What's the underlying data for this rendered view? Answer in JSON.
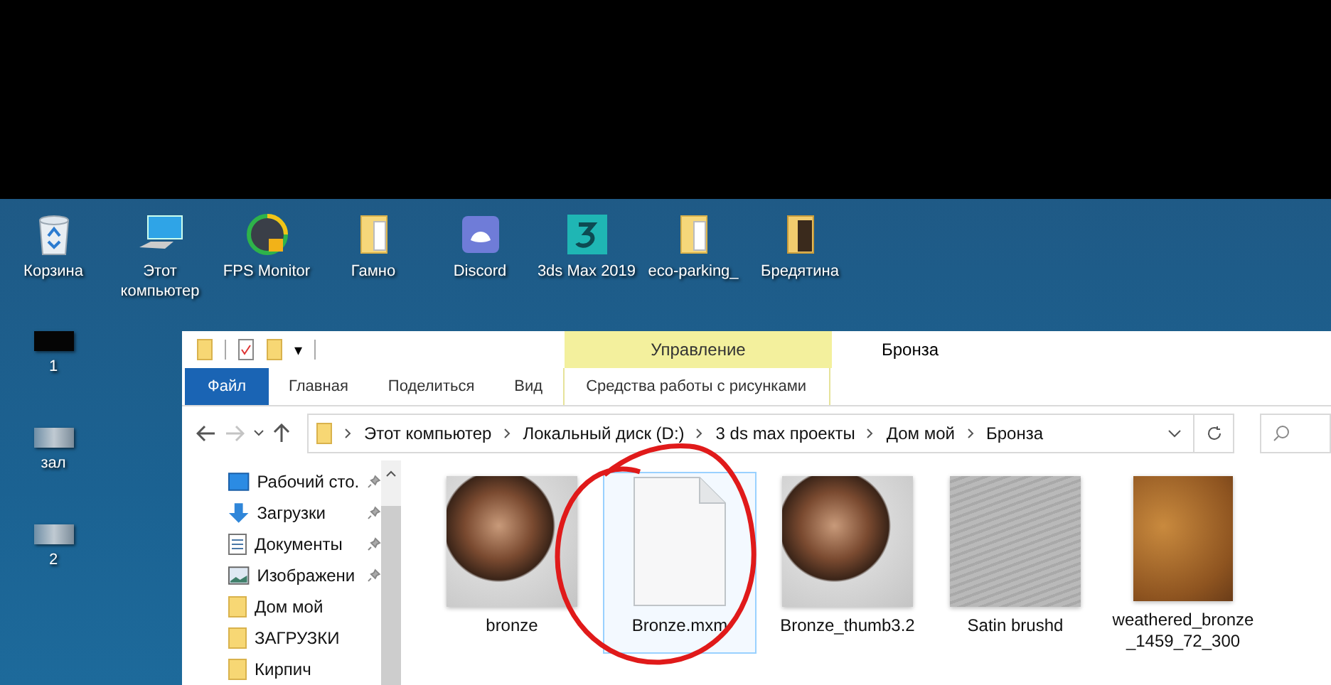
{
  "desktop": {
    "top_icons": [
      {
        "label": "Корзина",
        "kind": "recycle"
      },
      {
        "label": "Этот компьютер",
        "kind": "computer"
      },
      {
        "label": "FPS Monitor",
        "kind": "gauge"
      },
      {
        "label": "Гамно",
        "kind": "folder"
      },
      {
        "label": "Discord",
        "kind": "chat"
      },
      {
        "label": "3ds Max 2019",
        "kind": "max"
      },
      {
        "label": "eco-parking_",
        "kind": "folder"
      },
      {
        "label": "Бредятина",
        "kind": "darkfolder"
      }
    ],
    "side_icons": [
      {
        "label": "1",
        "kind": "dark"
      },
      {
        "label": "зал",
        "kind": "photo"
      },
      {
        "label": "2",
        "kind": "photo"
      }
    ]
  },
  "window": {
    "title": "Бронза",
    "quick_access_separator": "▾",
    "context_group": "Управление",
    "tabs": [
      {
        "label": "Файл",
        "kind": "file"
      },
      {
        "label": "Главная",
        "kind": "plain"
      },
      {
        "label": "Поделиться",
        "kind": "plain"
      },
      {
        "label": "Вид",
        "kind": "plain"
      },
      {
        "label": "Средства работы с рисунками",
        "kind": "context"
      }
    ],
    "breadcrumb": [
      "Этот компьютер",
      "Локальный диск (D:)",
      "3 ds max проекты",
      "Дом мой",
      "Бронза"
    ],
    "nav_items": [
      {
        "label": "Рабочий сто.",
        "kind": "desktop",
        "pinned": true
      },
      {
        "label": "Загрузки",
        "kind": "download",
        "pinned": true
      },
      {
        "label": "Документы",
        "kind": "document",
        "pinned": true
      },
      {
        "label": "Изображени",
        "kind": "image",
        "pinned": true
      },
      {
        "label": "Дом мой",
        "kind": "folder",
        "pinned": false
      },
      {
        "label": "ЗАГРУЗКИ",
        "kind": "folder",
        "pinned": false
      },
      {
        "label": "Кирпич",
        "kind": "folder",
        "pinned": false
      }
    ],
    "files": [
      {
        "name": "bronze",
        "kind": "sphere",
        "selected": false
      },
      {
        "name": "Bronze.mxm",
        "kind": "document",
        "selected": true
      },
      {
        "name": "Bronze_thumb3.2",
        "kind": "sphere",
        "selected": false
      },
      {
        "name": "Satin brushd",
        "kind": "satin",
        "selected": false
      },
      {
        "name": "weathered_bronze_1459_72_300",
        "kind": "rust",
        "selected": false
      }
    ]
  }
}
